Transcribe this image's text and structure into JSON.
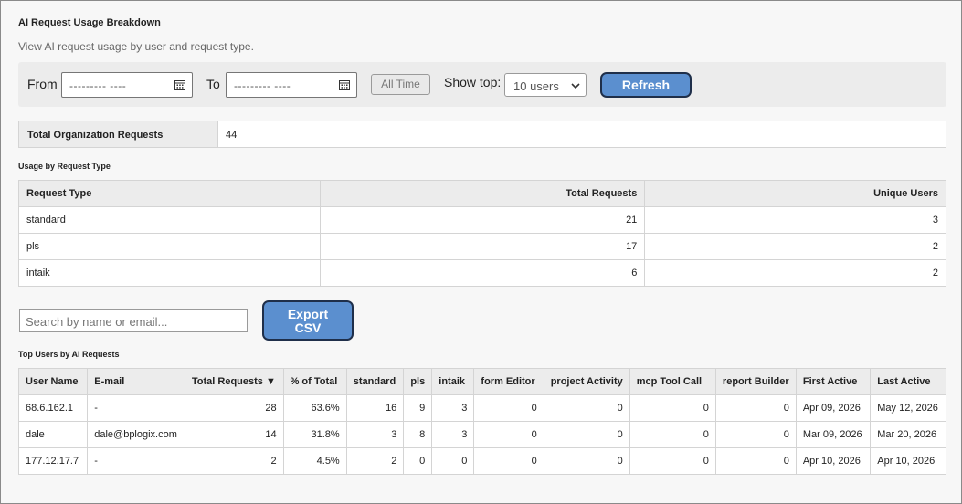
{
  "header": {
    "title": "AI Request Usage Breakdown",
    "subtitle": "View AI request usage by user and request type."
  },
  "filters": {
    "from_label": "From",
    "from_value": "--------- ----",
    "to_label": "To",
    "to_value": "--------- ----",
    "all_time_label": "All Time",
    "show_top_label": "Show top:",
    "show_top_value": "10 users",
    "refresh_label": "Refresh"
  },
  "total": {
    "label": "Total Organization Requests",
    "value": "44"
  },
  "request_types": {
    "section_title": "Usage by Request Type",
    "headers": [
      "Request Type",
      "Total Requests",
      "Unique Users"
    ],
    "rows": [
      [
        "standard",
        "21",
        "3"
      ],
      [
        "pls",
        "17",
        "2"
      ],
      [
        "intaik",
        "6",
        "2"
      ]
    ]
  },
  "search": {
    "placeholder": "Search by name or email..."
  },
  "export_label": "Export CSV",
  "top_users": {
    "section_title": "Top Users by AI Requests",
    "headers": [
      "User Name",
      "E-mail",
      "Total Requests ▼",
      "% of Total",
      "standard",
      "pls",
      "intaik",
      "form Editor",
      "project Activity",
      "mcp Tool Call",
      "report Builder",
      "First Active",
      "Last Active"
    ],
    "rows": [
      [
        "68.6.162.1",
        "-",
        "28",
        "63.6%",
        "16",
        "9",
        "3",
        "0",
        "0",
        "0",
        "0",
        "Apr 09, 2026",
        "May 12, 2026"
      ],
      [
        "dale",
        "dale@bplogix.com",
        "14",
        "31.8%",
        "3",
        "8",
        "3",
        "0",
        "0",
        "0",
        "0",
        "Mar 09, 2026",
        "Mar 20, 2026"
      ],
      [
        "177.12.17.7",
        "-",
        "2",
        "4.5%",
        "2",
        "0",
        "0",
        "0",
        "0",
        "0",
        "0",
        "Apr 10, 2026",
        "Apr 10, 2026"
      ]
    ]
  }
}
